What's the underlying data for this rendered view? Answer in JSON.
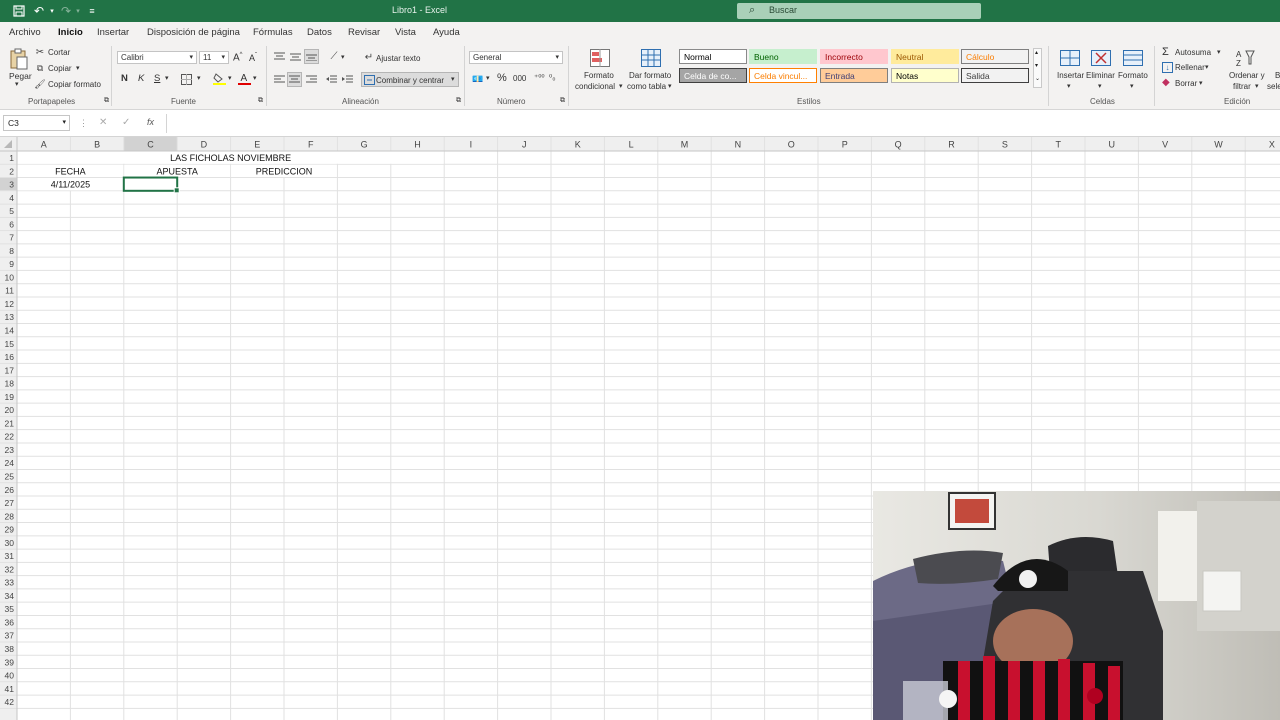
{
  "titlebar": {
    "title": "Libro1  -  Excel",
    "search_placeholder": "Buscar",
    "accent": "#217346"
  },
  "tabs": [
    "Archivo",
    "Inicio",
    "Insertar",
    "Disposición de página",
    "Fórmulas",
    "Datos",
    "Revisar",
    "Vista",
    "Ayuda"
  ],
  "active_tab": "Inicio",
  "ribbon": {
    "clipboard": {
      "paste": "Pegar",
      "cut": "Cortar",
      "copy": "Copiar",
      "format_painter": "Copiar formato",
      "label": "Portapapeles"
    },
    "font": {
      "name": "Calibri",
      "size": "11",
      "bold": "N",
      "italic": "K",
      "underline": "S",
      "label": "Fuente"
    },
    "alignment": {
      "wrap": "Ajustar texto",
      "merge": "Combinar y centrar",
      "label": "Alineación"
    },
    "number": {
      "format": "General",
      "label": "Número"
    },
    "styles": {
      "cond_format": [
        "Formato",
        "condicional"
      ],
      "table_format": [
        "Dar formato",
        "como tabla"
      ],
      "cells": [
        {
          "name": "Normal",
          "bg": "#ffffff",
          "fg": "#000000",
          "border": "#8a8a8a"
        },
        {
          "name": "Bueno",
          "bg": "#c6efce",
          "fg": "#006100",
          "border": "#c6efce"
        },
        {
          "name": "Incorrecto",
          "bg": "#ffc7ce",
          "fg": "#9c0006",
          "border": "#ffc7ce"
        },
        {
          "name": "Neutral",
          "bg": "#ffeb9c",
          "fg": "#9c5700",
          "border": "#ffeb9c"
        },
        {
          "name": "Cálculo",
          "bg": "#f2f2f2",
          "fg": "#fa7d00",
          "border": "#7f7f7f"
        },
        {
          "name": "Celda de co...",
          "bg": "#a5a5a5",
          "fg": "#ffffff",
          "border": "#3f3f3f"
        },
        {
          "name": "Celda vincul...",
          "bg": "#ffffff",
          "fg": "#fa7d00",
          "border": "#ff8001"
        },
        {
          "name": "Entrada",
          "bg": "#ffcc99",
          "fg": "#3f3f76",
          "border": "#7f7f7f"
        },
        {
          "name": "Notas",
          "bg": "#ffffcc",
          "fg": "#000000",
          "border": "#b2b2b2"
        },
        {
          "name": "Salida",
          "bg": "#f2f2f2",
          "fg": "#3f3f3f",
          "border": "#3f3f3f"
        }
      ],
      "label": "Estilos"
    },
    "cells_group": {
      "insert": "Insertar",
      "delete": "Eliminar",
      "format": "Formato",
      "label": "Celdas"
    },
    "editing": {
      "autosum": "Autosuma",
      "fill": "Rellenar",
      "clear": "Borrar",
      "sort": [
        "Ordenar y",
        "filtrar"
      ],
      "find": [
        "B",
        "sele"
      ],
      "label": "Edición"
    }
  },
  "formula_bar": {
    "name_box": "C3",
    "fx": "fx",
    "content": ""
  },
  "sheet": {
    "columns": [
      "A",
      "B",
      "C",
      "D",
      "E",
      "F",
      "G",
      "H",
      "I",
      "J",
      "K",
      "L",
      "M",
      "N",
      "O",
      "P",
      "Q",
      "R",
      "S",
      "T",
      "U",
      "V",
      "W",
      "X"
    ],
    "row_count": 42,
    "cells": [
      {
        "row": 1,
        "col_start": "A",
        "col_end": "H",
        "value": "LAS FICHOLAS NOVIEMBRE",
        "align": "center"
      },
      {
        "row": 2,
        "col_start": "A",
        "col_end": "B",
        "value": "FECHA",
        "align": "center"
      },
      {
        "row": 2,
        "col_start": "C",
        "col_end": "D",
        "value": "APUESTA",
        "align": "center"
      },
      {
        "row": 2,
        "col_start": "E",
        "col_end": "F",
        "value": "PREDICCION",
        "align": "center"
      },
      {
        "row": 3,
        "col_start": "A",
        "col_end": "B",
        "value": "4/11/2025",
        "align": "center"
      }
    ],
    "selected": "C3"
  },
  "webcam": {
    "jersey_colors": [
      "#c8102e",
      "#111111"
    ],
    "wall": "#e7e6e2"
  }
}
